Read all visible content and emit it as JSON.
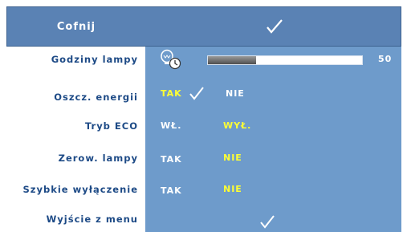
{
  "header": {
    "label": "Cofnij",
    "check_icon": "checkmark-icon"
  },
  "menu": {
    "lamp_hours": {
      "label": "Godziny lampy",
      "icon": "lamp-clock-icon",
      "value": "50",
      "level_fraction": 0.31
    },
    "power_saving": {
      "label": "Oszcz. energii",
      "option_yes": "TAK",
      "option_no": "NIE",
      "selected": "TAK"
    },
    "eco_mode": {
      "label": "Tryb ECO",
      "option_on": "WŁ.",
      "option_off": "WYŁ.",
      "selected": "WYŁ."
    },
    "lamp_reset": {
      "label": "Zerow. lampy",
      "option_yes": "TAK",
      "option_no": "NIE",
      "selected": "NIE"
    },
    "quick_shutdown": {
      "label": "Szybkie wyłączenie",
      "option_yes": "TAK",
      "option_no": "NIE",
      "selected": "NIE"
    },
    "exit": {
      "label": "Wyjście z menu",
      "check_icon": "checkmark-icon"
    }
  },
  "colors": {
    "header_bg": "#5a82b4",
    "panel_bg": "#6e9bcb",
    "label_text": "#1d4a86",
    "selected_text": "#ffff33",
    "unselected_text": "#ffffff"
  }
}
